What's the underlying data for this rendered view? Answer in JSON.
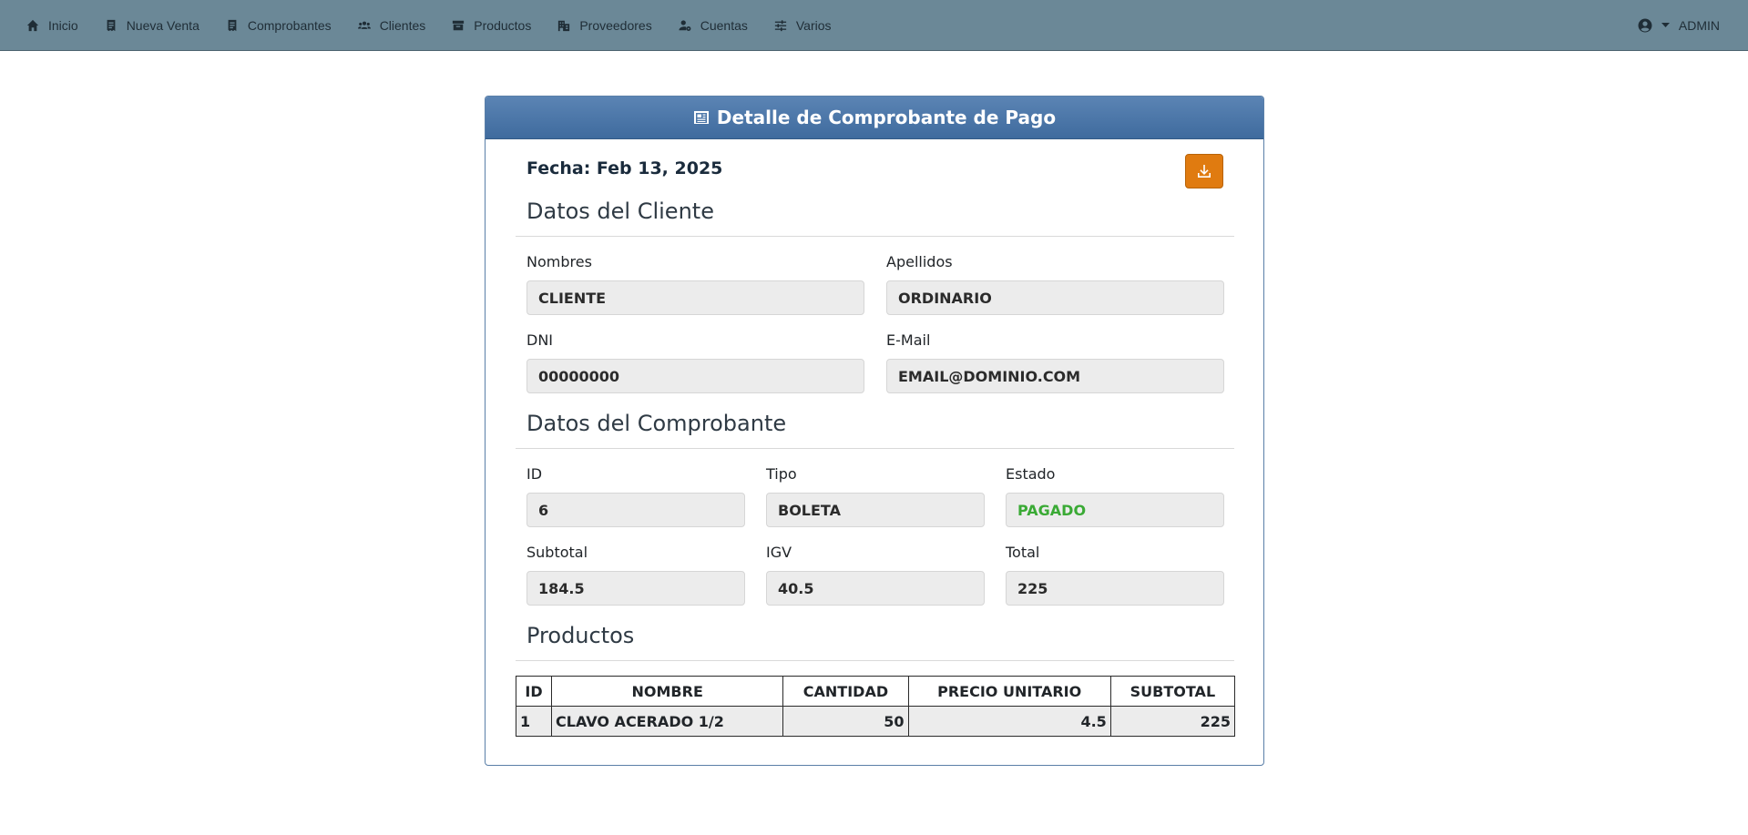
{
  "navbar": {
    "items": [
      {
        "label": "Inicio",
        "icon": "home-icon"
      },
      {
        "label": "Nueva Venta",
        "icon": "receipt-icon"
      },
      {
        "label": "Comprobantes",
        "icon": "receipt-icon"
      },
      {
        "label": "Clientes",
        "icon": "users-icon"
      },
      {
        "label": "Productos",
        "icon": "archive-icon"
      },
      {
        "label": "Proveedores",
        "icon": "building-icon"
      },
      {
        "label": "Cuentas",
        "icon": "user-gear-icon"
      },
      {
        "label": "Varios",
        "icon": "sliders-icon"
      }
    ],
    "user_label": "ADMIN"
  },
  "card": {
    "title": "Detalle de Comprobante de Pago",
    "fecha": "Fecha: Feb 13, 2025"
  },
  "cliente": {
    "section_title": "Datos del Cliente",
    "nombres_label": "Nombres",
    "nombres_value": "CLIENTE",
    "apellidos_label": "Apellidos",
    "apellidos_value": "ORDINARIO",
    "dni_label": "DNI",
    "dni_value": "00000000",
    "email_label": "E-Mail",
    "email_value": "EMAIL@DOMINIO.COM"
  },
  "comprobante": {
    "section_title": "Datos del Comprobante",
    "id_label": "ID",
    "id_value": "6",
    "tipo_label": "Tipo",
    "tipo_value": "BOLETA",
    "estado_label": "Estado",
    "estado_value": "PAGADO",
    "subtotal_label": "Subtotal",
    "subtotal_value": "184.5",
    "igv_label": "IGV",
    "igv_value": "40.5",
    "total_label": "Total",
    "total_value": "225"
  },
  "productos": {
    "section_title": "Productos",
    "headers": [
      "ID",
      "NOMBRE",
      "CANTIDAD",
      "PRECIO UNITARIO",
      "SUBTOTAL"
    ],
    "rows": [
      {
        "id": "1",
        "nombre": "CLAVO ACERADO 1/2",
        "cantidad": "50",
        "precio": "4.5",
        "subtotal": "225"
      }
    ]
  },
  "colors": {
    "navbar": "#6b8897",
    "card_header": "#4a75a8",
    "download_button": "#e07b10",
    "paid_status": "#3aaa35"
  }
}
